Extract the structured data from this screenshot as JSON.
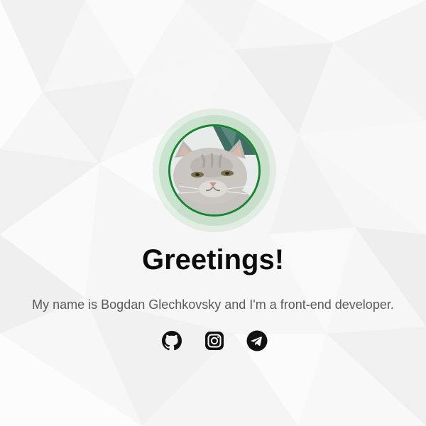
{
  "hero": {
    "title": "Greetings!",
    "subtitle": "My name is Bogdan Glechkovsky and I'm a front-end developer.",
    "avatar_alt": "cat photo avatar"
  },
  "socials": [
    {
      "name": "github",
      "icon": "github-icon"
    },
    {
      "name": "instagram",
      "icon": "instagram-icon"
    },
    {
      "name": "telegram",
      "icon": "telegram-icon"
    }
  ],
  "colors": {
    "accent": "#17852f",
    "title": "#0c0c0c",
    "text": "#5a5a5a",
    "background": "#f6f6f6"
  }
}
